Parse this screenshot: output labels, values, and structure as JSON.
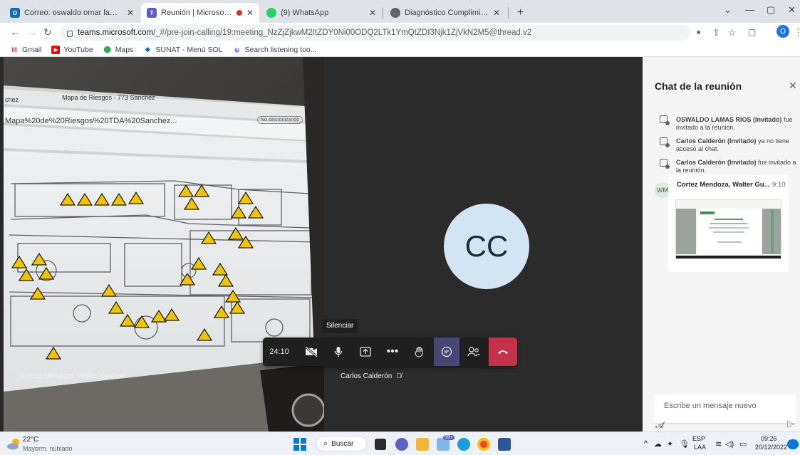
{
  "browser": {
    "tabs": [
      {
        "label": "Correo: oswaldo omar lamas rios",
        "icon": "outlook-icon"
      },
      {
        "label": "Reunión | Microsoft Teams",
        "icon": "teams-icon",
        "recording": true
      },
      {
        "label": "(9) WhatsApp",
        "icon": "whatsapp-icon"
      },
      {
        "label": "Diagnóstico Cumplimiento Ley 2",
        "icon": "web-icon"
      }
    ],
    "new_tab": "+",
    "url_host": "teams.microsoft.com",
    "url_path": "/_#/pre-join-calling/19:meeting_NzZjZjkwM2ItZDY0Ni00ODQ2LTk1YmQtZDI3Njk1ZjVkN2M5@thread.v2",
    "profile_initial": "O",
    "bookmarks": [
      "Gmail",
      "YouTube",
      "Maps",
      "SUNAT - Menú SOL",
      "Search listening too..."
    ]
  },
  "meeting": {
    "participant_left": "Cortez Mendoza, Walter Gustavo",
    "participant_right": "Carlos Calderón",
    "avatar_initials": "CC",
    "timer": "24:10",
    "tooltip": "Silenciar"
  },
  "shared_screen": {
    "tab_left": "chez",
    "tab_title": "Mapa de Riesgos - 773 Sanchez",
    "url_fragment": "Mapa%20de%20Riesgos%20TDA%20Sanchez...",
    "sync_badge": "No sincronizando"
  },
  "chat": {
    "title": "Chat de la reunión",
    "system_messages": [
      {
        "bold": "OSWALDO LAMAS RIOS (Invitado)",
        "text": " fue invitado a la reunión."
      },
      {
        "bold": "Carlos Calderón (Invitado)",
        "text": " ya no tiene acceso al chat."
      },
      {
        "bold": "Carlos Calderón (Invitado)",
        "text": " fue invitado a la reunión."
      }
    ],
    "message_sender": "Cortez Mendoza, Walter Gu...",
    "message_time": "9:10",
    "sender_initials": "WM",
    "compose_placeholder": "Escribe un mensaje nuevo"
  },
  "taskbar": {
    "weather_temp": "22°C",
    "weather_desc": "Mayorm. nublado",
    "search_label": "Buscar",
    "lang_top": "ESP",
    "lang_bottom": "LAA",
    "time": "09:26",
    "date": "20/12/2022",
    "notification_badge": "99+"
  },
  "colors": {
    "teams_purple": "#5b5fc7",
    "leave_red": "#c4314b",
    "avatar_bg": "#d3e4f2"
  }
}
